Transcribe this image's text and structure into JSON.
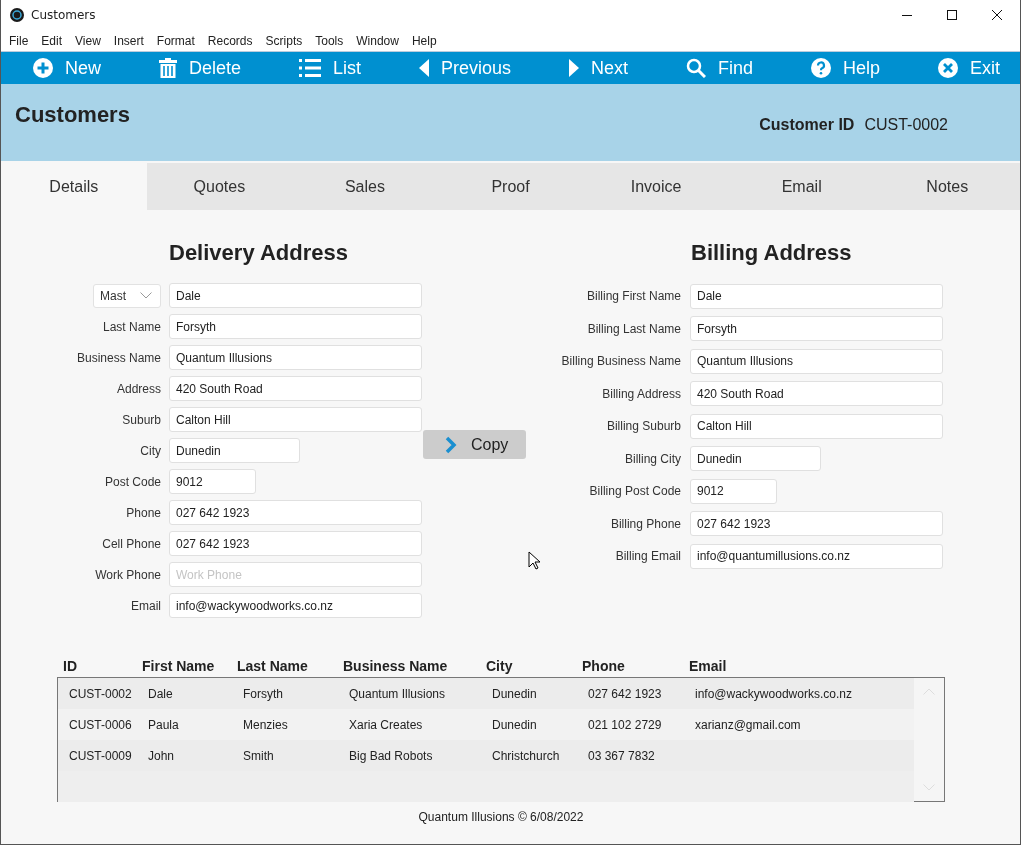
{
  "window": {
    "title": "Customers"
  },
  "menu": [
    "File",
    "Edit",
    "View",
    "Insert",
    "Format",
    "Records",
    "Scripts",
    "Tools",
    "Window",
    "Help"
  ],
  "toolbar": [
    {
      "label": "New",
      "kind": "new"
    },
    {
      "label": "Delete",
      "kind": "delete"
    },
    {
      "label": "List",
      "kind": "list"
    },
    {
      "label": "Previous",
      "kind": "previous"
    },
    {
      "label": "Next",
      "kind": "next"
    },
    {
      "label": "Find",
      "kind": "find"
    },
    {
      "label": "Help",
      "kind": "help"
    },
    {
      "label": "Exit",
      "kind": "exit"
    }
  ],
  "header": {
    "title": "Customers",
    "id_label": "Customer ID",
    "id_value": "CUST-0002"
  },
  "tabs": [
    {
      "label": "Details",
      "selected": true
    },
    {
      "label": "Quotes",
      "selected": false
    },
    {
      "label": "Sales",
      "selected": false
    },
    {
      "label": "Proof",
      "selected": false
    },
    {
      "label": "Invoice",
      "selected": false
    },
    {
      "label": "Email",
      "selected": false
    },
    {
      "label": "Notes",
      "selected": false
    }
  ],
  "delivery": {
    "heading": "Delivery Address",
    "title_select": "Mast",
    "fields": [
      {
        "value": "Dale",
        "kind": "full"
      },
      {
        "label": "Last Name",
        "value": "Forsyth",
        "kind": "full"
      },
      {
        "label": "Business Name",
        "value": "Quantum Illusions",
        "kind": "full"
      },
      {
        "label": "Address",
        "value": "420 South Road",
        "kind": "full"
      },
      {
        "label": "Suburb",
        "value": "Calton Hill",
        "kind": "full"
      },
      {
        "label": "City",
        "value": "Dunedin",
        "kind": "medium"
      },
      {
        "label": "Post Code",
        "value": "9012",
        "kind": "short"
      },
      {
        "label": "Phone",
        "value": "027 642 1923",
        "kind": "full"
      },
      {
        "label": "Cell Phone",
        "value": "027 642 1923",
        "kind": "full"
      },
      {
        "label": "Work Phone",
        "placeholder": "Work Phone",
        "kind": "full"
      },
      {
        "label": "Email",
        "value": "info@wackywoodworks.co.nz",
        "kind": "full"
      }
    ]
  },
  "copy_button": "Copy",
  "billing": {
    "heading": "Billing Address",
    "fields": [
      {
        "label": "Billing First Name",
        "value": "Dale",
        "kind": "full"
      },
      {
        "label": "Billing Last Name",
        "value": "Forsyth",
        "kind": "full"
      },
      {
        "label": "Billing Business Name",
        "value": "Quantum Illusions",
        "kind": "full"
      },
      {
        "label": "Billing Address",
        "value": "420 South Road",
        "kind": "full"
      },
      {
        "label": "Billing Suburb",
        "value": "Calton Hill",
        "kind": "full"
      },
      {
        "label": "Billing City",
        "value": "Dunedin",
        "kind": "medium"
      },
      {
        "label": "Billing Post Code",
        "value": "9012",
        "kind": "short"
      },
      {
        "label": "Billing Phone",
        "value": "027 642 1923",
        "kind": "full"
      },
      {
        "label": "Billing Email",
        "value": "info@quantumillusions.co.nz",
        "kind": "full"
      }
    ]
  },
  "table": {
    "columns": [
      "ID",
      "First Name",
      "Last Name",
      "Business Name",
      "City",
      "Phone",
      "Email"
    ],
    "rows": [
      [
        "CUST-0002",
        "Dale",
        "Forsyth",
        "Quantum Illusions",
        "Dunedin",
        "027 642 1923",
        "info@wackywoodworks.co.nz"
      ],
      [
        "CUST-0006",
        "Paula",
        "Menzies",
        "Xaria Creates",
        "Dunedin",
        "021 102 2729",
        "xarianz@gmail.com"
      ],
      [
        "CUST-0009",
        "John",
        "Smith",
        "Big Bad Robots",
        "Christchurch",
        "03 367 7832"
      ]
    ]
  },
  "footer": "Quantum Illusions © 6/08/2022"
}
